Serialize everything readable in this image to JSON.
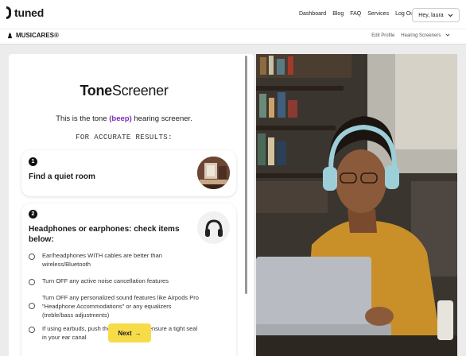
{
  "brand": {
    "name": "tuned"
  },
  "nav": {
    "items": [
      "Dashboard",
      "Blog",
      "FAQ",
      "Services",
      "Log Out"
    ],
    "user_label": "Hey, laura"
  },
  "subheader": {
    "partner": "MUSICARES®",
    "links": [
      "Edit Profile",
      "Hearing Screeners"
    ]
  },
  "screener": {
    "title_bold": "Tone",
    "title_rest": "Screener",
    "intro_before": "This is the tone ",
    "intro_highlight": "(beep)",
    "intro_after": " hearing screener.",
    "accurate": "FOR ACCURATE RESULTS:",
    "steps": [
      {
        "number": "1",
        "title": "Find a quiet room"
      },
      {
        "number": "2",
        "title": "Headphones or earphones: check items below:"
      }
    ],
    "checklist": [
      "Ear/headphones WITH cables are better than wireless/Bluetooth",
      "Turn OFF any active noise cancellation features",
      "Turn OFF any personalized sound features like Airpods Pro \"Headphone Accommodations\" or any equalizers (treble/bass adjustments)",
      "If using earbuds, push the earbuds in to ensure a tight seal in your ear canal"
    ],
    "next_label": "Next",
    "next_arrow": "→"
  },
  "colors": {
    "accent": "#7b2dba",
    "button": "#f7dc4a"
  },
  "icons": [
    "chevron-down-icon",
    "room-image",
    "headphones-icon",
    "arrow-right-icon"
  ]
}
